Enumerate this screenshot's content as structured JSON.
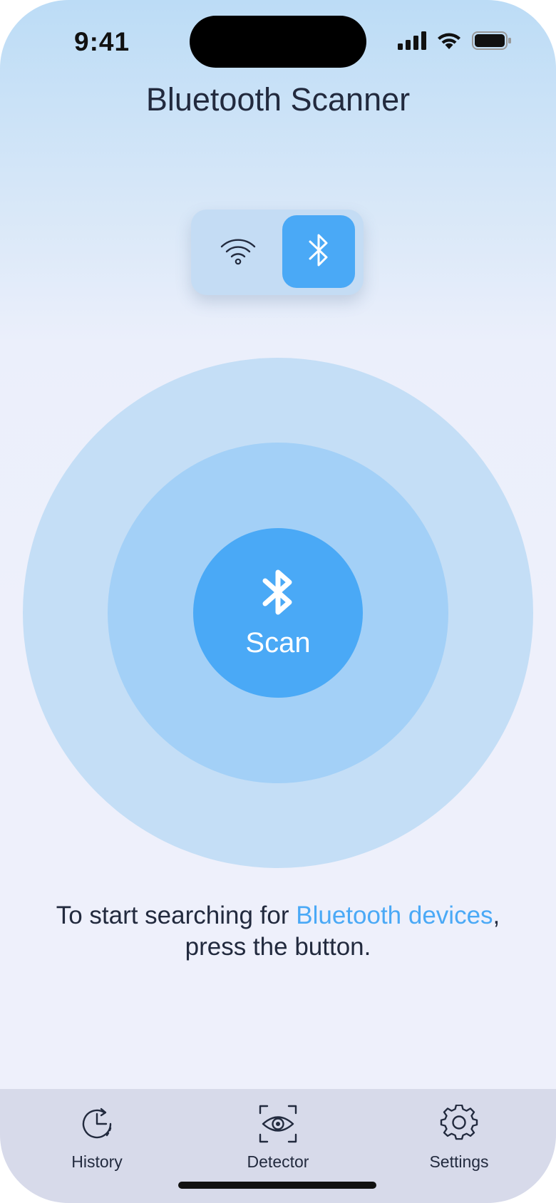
{
  "status_bar": {
    "time": "9:41",
    "icons": [
      "cellular-signal-icon",
      "wifi-icon",
      "battery-icon"
    ]
  },
  "header": {
    "title": "Bluetooth Scanner"
  },
  "mode_toggle": {
    "options": [
      {
        "icon": "wifi-icon",
        "selected": false
      },
      {
        "icon": "bluetooth-icon",
        "selected": true
      }
    ]
  },
  "scan": {
    "icon": "bluetooth-icon",
    "label": "Scan"
  },
  "hint": {
    "prefix": "To start searching for ",
    "link": "Bluetooth devices",
    "suffix": ",",
    "line2": "press the button."
  },
  "tabbar": {
    "tabs": [
      {
        "label": "History",
        "icon": "history-clock-icon"
      },
      {
        "label": "Detector",
        "icon": "eye-scan-icon"
      },
      {
        "label": "Settings",
        "icon": "gear-icon"
      }
    ]
  },
  "colors": {
    "accent": "#4aa9f6",
    "text": "#222a3e",
    "tabbar_bg": "#d7daea",
    "ring_outer": "#c4def6",
    "ring_mid": "#a3d0f7"
  }
}
